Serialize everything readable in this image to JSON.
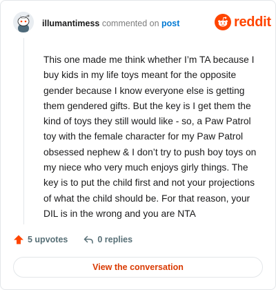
{
  "comment": {
    "username": "illumantimess",
    "action_text": "commented on",
    "post_link": "post",
    "body": "This one made me think whether I’m TA because I buy kids in my life toys meant for the opposite gender because I know everyone else is getting them gendered gifts. But the key is I get them the kind of toys they still would like - so, a Paw Patrol toy with the female character for my Paw Patrol obsessed nephew & I don’t try to push boy toys on my niece who very much enjoys girly things. The key is to put the child first and not your projections of what the child should be. For that reason, your DIL is in the wrong and you are NTA"
  },
  "brand": {
    "name": "reddit",
    "logo_icon": "reddit-alien-icon",
    "color": "#ff4500"
  },
  "footer": {
    "upvotes": "5 upvotes",
    "replies": "0 replies",
    "view_button": "View the conversation"
  },
  "colors": {
    "link": "#0079d3",
    "upvote_arrow": "#ff4500",
    "muted": "#576f76",
    "button_text": "#d93900"
  }
}
